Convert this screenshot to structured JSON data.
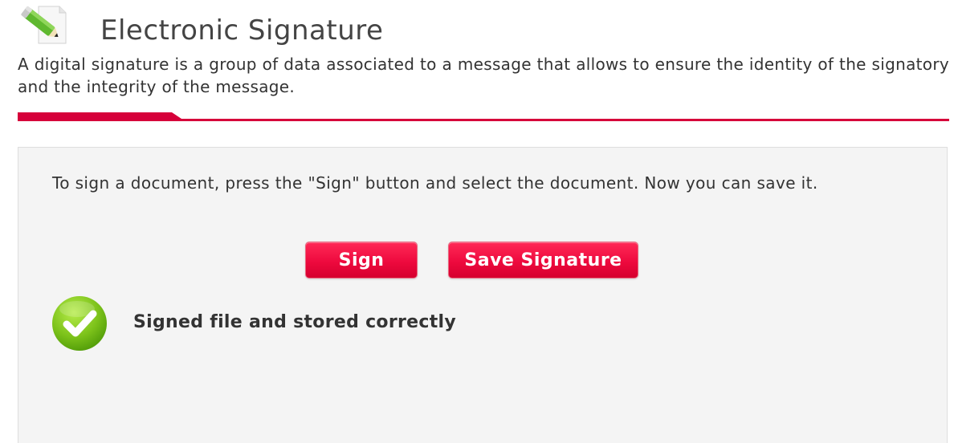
{
  "header": {
    "icon": "pencil-signature-icon",
    "title": "Electronic Signature"
  },
  "description": "A digital signature is a group of data associated to a message that allows to ensure the identity of the signatory and the integrity of the message.",
  "colors": {
    "accent": "#d6003a",
    "panel_background": "#f4f4f4",
    "success": "#7cc21a"
  },
  "panel": {
    "instructions": "To sign a document, press the \"Sign\" button and select the document. Now you can save it.",
    "buttons": {
      "sign_label": "Sign",
      "save_label": "Save Signature"
    },
    "status": {
      "icon": "check-circle-icon",
      "message": "Signed file and stored correctly"
    }
  }
}
